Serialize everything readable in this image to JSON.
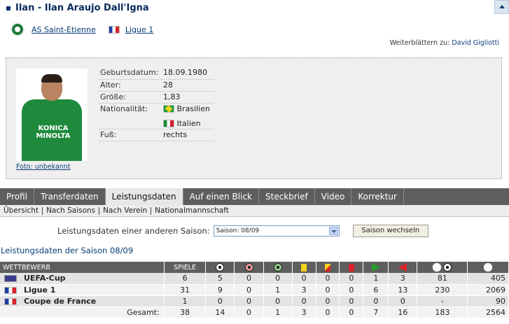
{
  "header": {
    "title": "Ilan - Ilan Araujo Dall'Igna"
  },
  "club": {
    "name": "AS Saint-Etienne",
    "league": "Ligue 1"
  },
  "browse": {
    "label": "Weiterblättern zu:",
    "name": "David Gigliotti"
  },
  "profile": {
    "photo_caption": "Foto: unbekannt",
    "photo_sponsor": "KONICA MINOLTA",
    "rows": [
      {
        "label": "Geburtsdatum:",
        "value": "18.09.1980"
      },
      {
        "label": "Alter:",
        "value": "28"
      },
      {
        "label": "Größe:",
        "value": "1,83"
      },
      {
        "label": "Nationalität:",
        "value": "Brasilien"
      },
      {
        "label": "",
        "value": "Italien"
      },
      {
        "label": "Fuß:",
        "value": "rechts"
      }
    ]
  },
  "tabs": [
    "Profil",
    "Transferdaten",
    "Leistungsdaten",
    "Auf einen Blick",
    "Steckbrief",
    "Video",
    "Korrektur"
  ],
  "active_tab": "Leistungsdaten",
  "subtabs": [
    "Übersicht",
    "Nach Saisons",
    "Nach Verein",
    "Nationalmannschaft"
  ],
  "season_select": {
    "label": "Leistungsdaten einer anderen Saison:",
    "value": "Saison: 08/09",
    "button": "Saison wechseln"
  },
  "season_heading": "Leistungsdaten der Saison 08/09",
  "stats": {
    "headers": {
      "competition": "WETTBEWERB",
      "games": "SPIELE"
    },
    "icons": [
      "goal-icon",
      "own-goal-icon",
      "assist-icon",
      "yellow-card-icon",
      "yellow-red-card-icon",
      "red-card-icon",
      "sub-in-icon",
      "sub-out-icon",
      "minutes-per-goal-icon",
      "minutes-played-icon"
    ],
    "rows": [
      {
        "competition": "UEFA-Cup",
        "flag": "uefa",
        "values": [
          "6",
          "5",
          "0",
          "0",
          "0",
          "0",
          "0",
          "1",
          "3",
          "81",
          "405"
        ]
      },
      {
        "competition": "Ligue 1",
        "flag": "fr",
        "values": [
          "31",
          "9",
          "0",
          "1",
          "3",
          "0",
          "0",
          "6",
          "13",
          "230",
          "2069"
        ]
      },
      {
        "competition": "Coupe de France",
        "flag": "fr",
        "values": [
          "1",
          "0",
          "0",
          "0",
          "0",
          "0",
          "0",
          "0",
          "0",
          "-",
          "90"
        ]
      }
    ],
    "total": {
      "label": "Gesamt:",
      "values": [
        "38",
        "14",
        "0",
        "1",
        "3",
        "0",
        "0",
        "7",
        "16",
        "183",
        "2564"
      ]
    }
  }
}
